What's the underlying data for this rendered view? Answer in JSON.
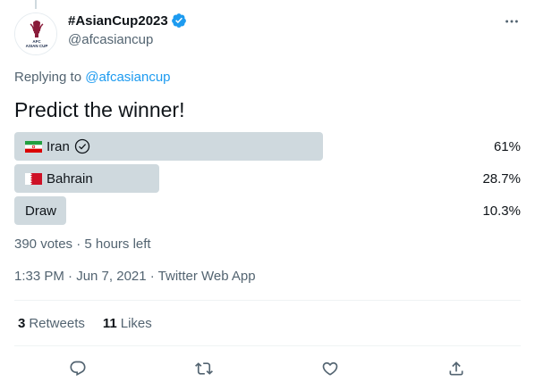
{
  "author": {
    "display_name": "#AsianCup2023",
    "handle": "@afcasiancup",
    "avatar_text_top": "AFC",
    "avatar_text_bottom": "ASIAN CUP"
  },
  "reply": {
    "prefix": "Replying to",
    "mention": "@afcasiancup"
  },
  "tweet": {
    "text": "Predict the winner!"
  },
  "poll": {
    "options": [
      {
        "label": "Iran",
        "percent_text": "61%",
        "fraction": 0.61,
        "winner": true,
        "flag": "iran-flag"
      },
      {
        "label": "Bahrain",
        "percent_text": "28.7%",
        "fraction": 0.287,
        "winner": false,
        "flag": "bahrain-flag"
      },
      {
        "label": "Draw",
        "percent_text": "10.3%",
        "fraction": 0.103,
        "winner": false,
        "flag": null
      }
    ],
    "meta": "390 votes · 5 hours left"
  },
  "timestamp": "1:33 PM · Jun 7, 2021 · Twitter Web App",
  "stats": {
    "retweets_count": "3",
    "retweets_label": "Retweets",
    "likes_count": "11",
    "likes_label": "Likes"
  },
  "colors": {
    "accent": "#1d9bf0",
    "bar": "#cfd9de",
    "muted": "#536471"
  },
  "icons": [
    "verified-badge-icon",
    "more-icon",
    "reply-icon",
    "retweet-icon",
    "like-icon",
    "share-icon",
    "check-circle-icon"
  ]
}
